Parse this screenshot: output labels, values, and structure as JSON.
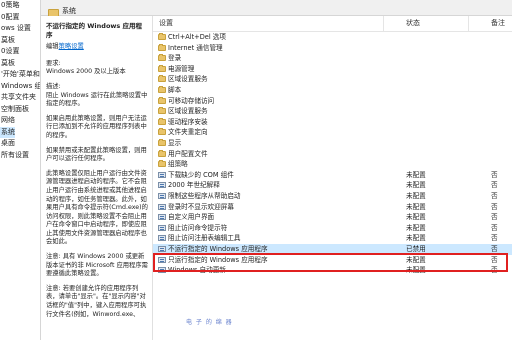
{
  "tree": {
    "items": [
      {
        "label": "0策略",
        "selected": false
      },
      {
        "label": "0配置",
        "selected": false
      },
      {
        "label": "ows 设置",
        "selected": false
      },
      {
        "label": "莫板",
        "selected": false
      },
      {
        "label": "0设置",
        "selected": false
      },
      {
        "label": "莫板",
        "selected": false
      },
      {
        "label": "'开始'菜单和",
        "selected": false
      },
      {
        "label": "Windows 组",
        "selected": false
      },
      {
        "label": "共享文件夹",
        "selected": false
      },
      {
        "label": "空制面板",
        "selected": false
      },
      {
        "label": "网络",
        "selected": false
      },
      {
        "label": "系统",
        "selected": true
      },
      {
        "label": "桌面",
        "selected": false
      },
      {
        "label": "所有设置",
        "selected": false
      }
    ]
  },
  "tab": {
    "label": "系统"
  },
  "description": {
    "title": "不运行指定的 Windows 应用程序",
    "edit_prefix": "编辑",
    "edit_link": "策略设置",
    "requirement_label": "要求:",
    "requirement_value": "Windows 2000 及以上版本",
    "desc_label": "描述:",
    "desc_text": "阻止 Windows 运行在此策略设置中指定的程序。",
    "enabled_text": "如果启用此策略设置，则用户无法运行已添加到不允许的应用程序列表中的程序。",
    "disabled_text": "如果禁用或未配置此策略设置，则用户可以运行任何程序。",
    "note1": "此策略设置仅阻止用户运行由文件资源管理器进程启动的程序。它不会阻止用户运行由系统进程或其他进程启动的程序，如任务管理器。此外，如果用户具有命令提示符(Cmd.exe)的访问权限，则此策略设置不会阻止用户在命令窗口中启动程序，即使应阻止其使用文件资源管理器启动程序也会如此。",
    "note2": "注意: 具有 Windows 2000 或更新版本证书的非 Microsoft 应用程序需要遵循此策略设置。",
    "note3": "注意: 若要创建允许的应用程序列表，请单击\"显示\"。在\"显示内容\"对话框的\"值\"列中，键入应用程序可执行文件名(例如，Winword.exe、"
  },
  "list": {
    "columns": {
      "setting": "设置",
      "state": "状态",
      "comment": "备注"
    },
    "rows": [
      {
        "name": "Ctrl+Alt+Del 选项",
        "type": "folder",
        "state": "",
        "comment": ""
      },
      {
        "name": "Internet 通信管理",
        "type": "folder",
        "state": "",
        "comment": ""
      },
      {
        "name": "登录",
        "type": "folder",
        "state": "",
        "comment": ""
      },
      {
        "name": "电源管理",
        "type": "folder",
        "state": "",
        "comment": ""
      },
      {
        "name": "区域设置服务",
        "type": "folder",
        "state": "",
        "comment": ""
      },
      {
        "name": "脚本",
        "type": "folder",
        "state": "",
        "comment": ""
      },
      {
        "name": "可移动存储访问",
        "type": "folder",
        "state": "",
        "comment": ""
      },
      {
        "name": "区域设置服务",
        "type": "folder",
        "state": "",
        "comment": ""
      },
      {
        "name": "驱动程序安装",
        "type": "folder",
        "state": "",
        "comment": ""
      },
      {
        "name": "文件夹重定向",
        "type": "folder",
        "state": "",
        "comment": ""
      },
      {
        "name": "显示",
        "type": "folder",
        "state": "",
        "comment": ""
      },
      {
        "name": "用户配置文件",
        "type": "folder",
        "state": "",
        "comment": ""
      },
      {
        "name": "组策略",
        "type": "folder",
        "state": "",
        "comment": ""
      },
      {
        "name": "下载缺少的 COM 组件",
        "type": "policy",
        "state": "未配置",
        "comment": "否"
      },
      {
        "name": "2000 年世纪解释",
        "type": "policy",
        "state": "未配置",
        "comment": "否"
      },
      {
        "name": "限制这些程序从帮助启动",
        "type": "policy",
        "state": "未配置",
        "comment": "否"
      },
      {
        "name": "登录时不显示欢迎屏幕",
        "type": "policy",
        "state": "未配置",
        "comment": "否"
      },
      {
        "name": "自定义用户界面",
        "type": "policy",
        "state": "未配置",
        "comment": "否"
      },
      {
        "name": "阻止访问命令提示符",
        "type": "policy",
        "state": "未配置",
        "comment": "否"
      },
      {
        "name": "阻止访问注册表编辑工具",
        "type": "policy",
        "state": "未配置",
        "comment": "否"
      },
      {
        "name": "不运行指定的 Windows 应用程序",
        "type": "policy",
        "state": "已禁用",
        "comment": "否",
        "selected": true
      },
      {
        "name": "只运行指定的 Windows 应用程序",
        "type": "policy",
        "state": "未配置",
        "comment": "否"
      },
      {
        "name": "Windows 自动更新",
        "type": "policy",
        "state": "未配置",
        "comment": "否"
      }
    ]
  },
  "watermark": "电 子 的 绵 器",
  "colors": {
    "highlight_border": "#e02020",
    "selection": "#cce8ff",
    "link": "#0066cc"
  }
}
